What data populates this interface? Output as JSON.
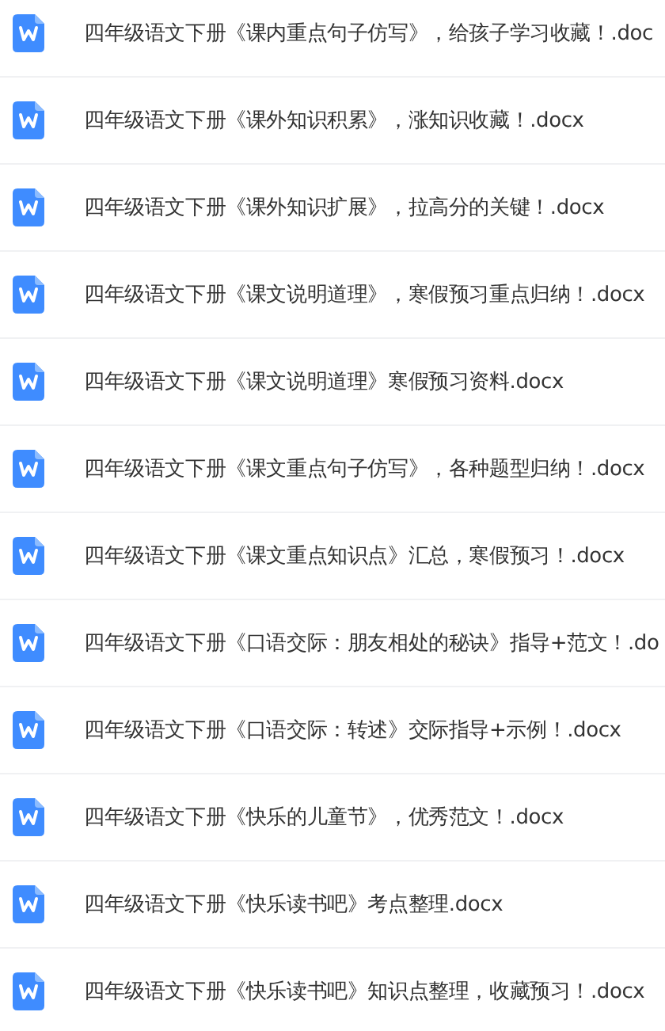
{
  "files": [
    {
      "name": "四年级语文下册《课内重点句子仿写》，给孩子学习收藏！.doc"
    },
    {
      "name": "四年级语文下册《课外知识积累》，涨知识收藏！.docx"
    },
    {
      "name": "四年级语文下册《课外知识扩展》，拉高分的关键！.docx"
    },
    {
      "name": "四年级语文下册《课文说明道理》，寒假预习重点归纳！.docx"
    },
    {
      "name": "四年级语文下册《课文说明道理》寒假预习资料.docx"
    },
    {
      "name": "四年级语文下册《课文重点句子仿写》，各种题型归纳！.docx"
    },
    {
      "name": "四年级语文下册《课文重点知识点》汇总，寒假预习！.docx"
    },
    {
      "name": "四年级语文下册《口语交际：朋友相处的秘诀》指导+范文！.do"
    },
    {
      "name": "四年级语文下册《口语交际：转述》交际指导+示例！.docx"
    },
    {
      "name": "四年级语文下册《快乐的儿童节》，优秀范文！.docx"
    },
    {
      "name": "四年级语文下册《快乐读书吧》考点整理.docx"
    },
    {
      "name": "四年级语文下册《快乐读书吧》知识点整理，收藏预习！.docx"
    }
  ]
}
